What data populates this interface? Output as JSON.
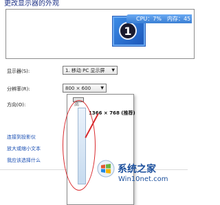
{
  "page": {
    "title": "更改显示器的外观"
  },
  "preview": {
    "monitor_number": "1",
    "cpu_label": "CPU：7%",
    "memory_label": "内存：45"
  },
  "form": {
    "display_label": "显示器(S):",
    "display_value": "1. 移动 PC 显示屏",
    "resolution_label": "分辨率(R):",
    "resolution_value": "800 × 600",
    "orientation_label": "方向(O):"
  },
  "popup": {
    "high_label": "高",
    "resolution_item": "1366 × 768 (推荐)"
  },
  "links": [
    "连接到投影仪",
    "放大或缩小文本",
    "我应该选择什么"
  ],
  "watermark": {
    "name": "系统之家",
    "url": "Win10net.com"
  },
  "colors": {
    "accent": "#1b55b8",
    "highlight": "#d8282c",
    "link": "#1a4fb3"
  }
}
